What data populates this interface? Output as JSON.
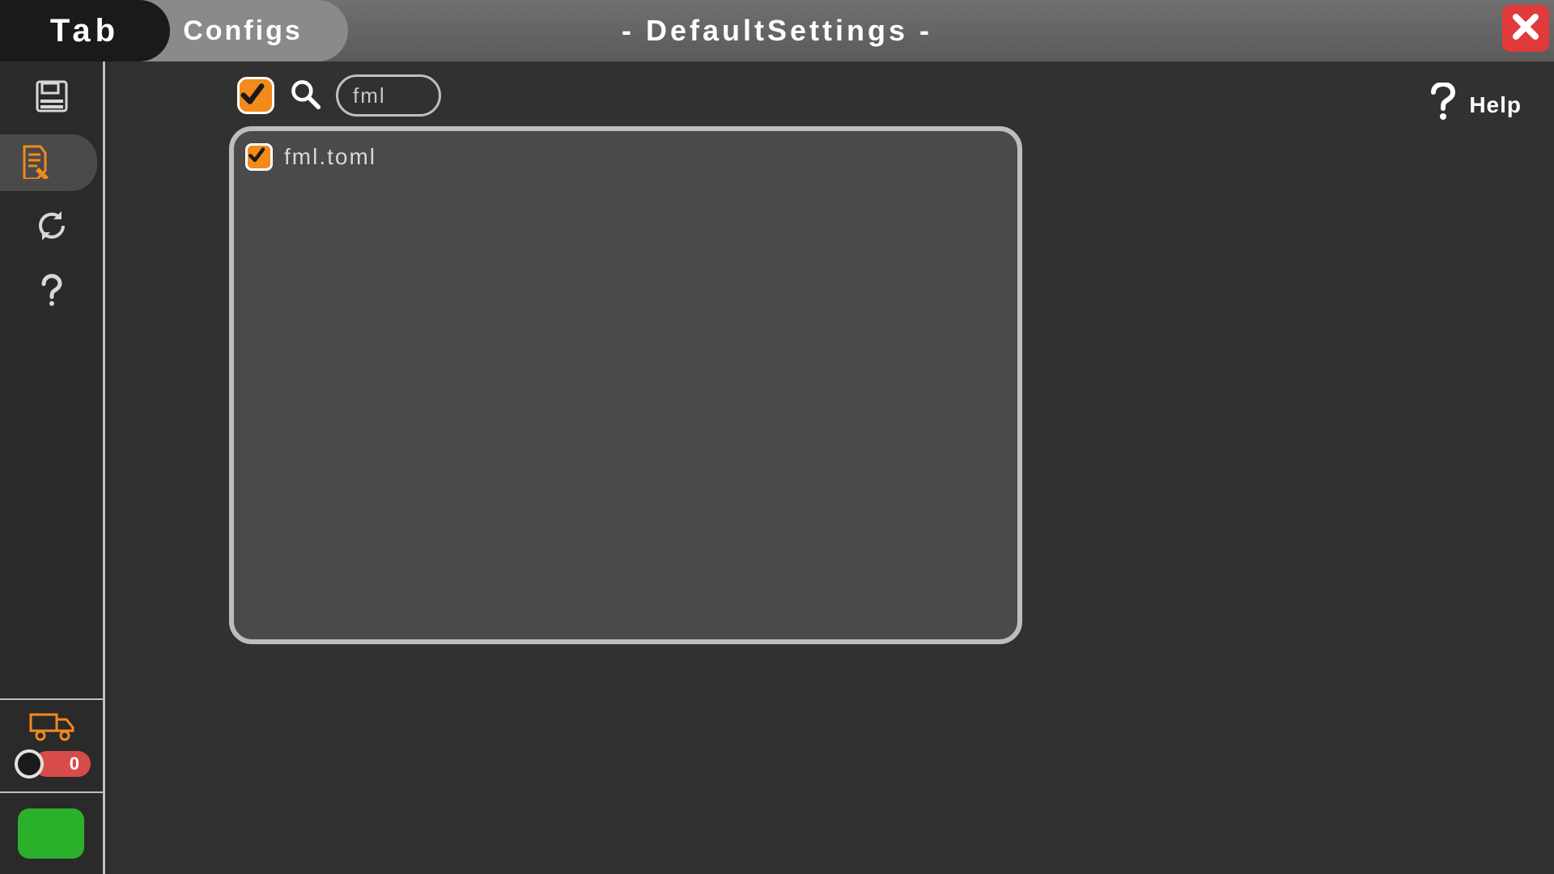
{
  "topbar": {
    "tab_label": "Tab",
    "configs_label": "Configs",
    "title": "- DefaultSettings -"
  },
  "toolbar": {
    "search_value": "fml"
  },
  "help": {
    "label": "Help"
  },
  "list": {
    "items": [
      {
        "label": "fml.toml",
        "checked": true
      }
    ]
  },
  "sidebar_bottom": {
    "toggle_value": "0"
  },
  "colors": {
    "accent": "#f28a1c",
    "danger": "#e03a3a",
    "success": "#2bb02b"
  }
}
